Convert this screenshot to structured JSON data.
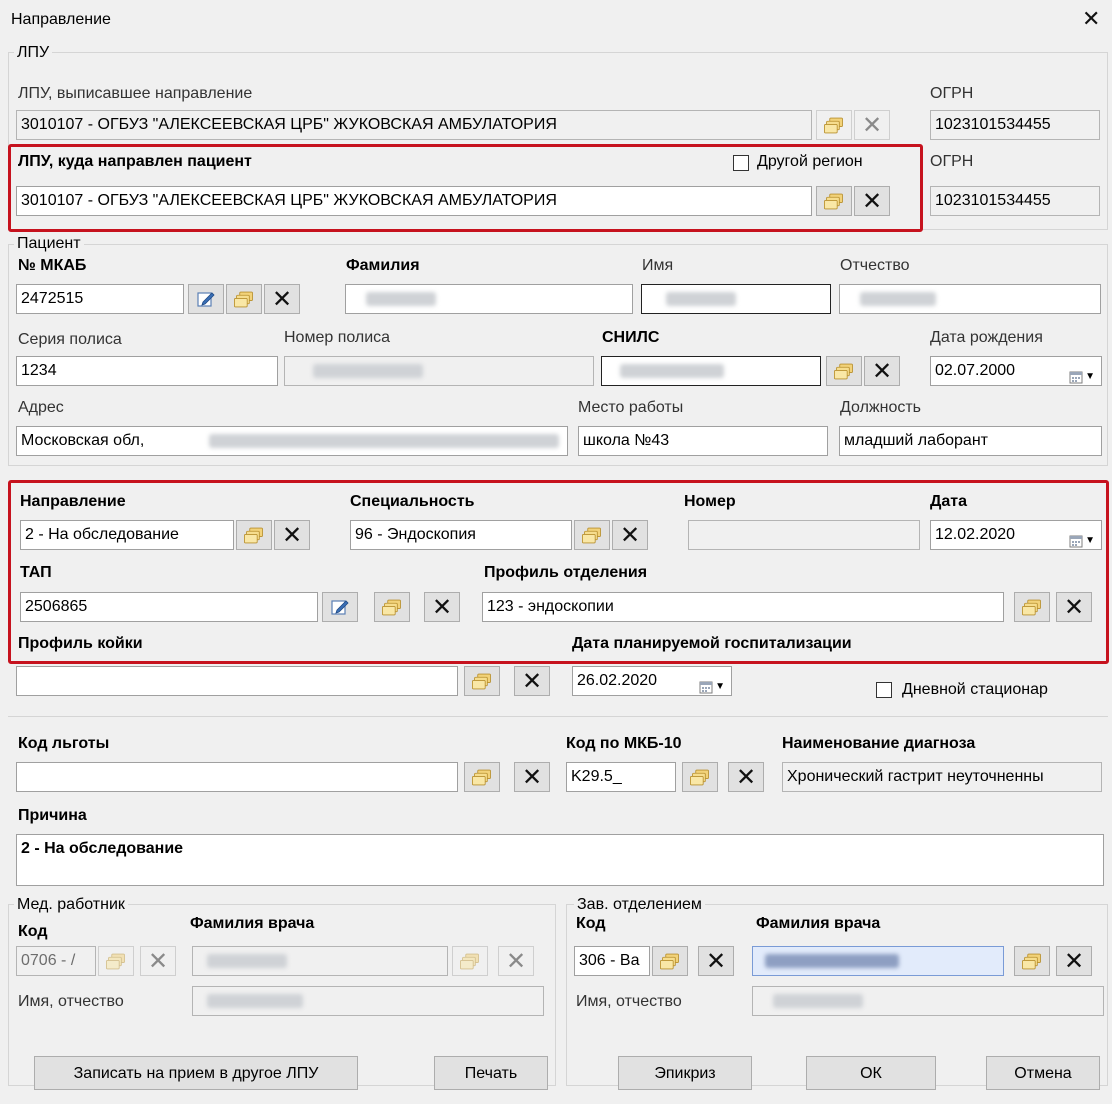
{
  "window": {
    "title": "Направление"
  },
  "lpu": {
    "legend": "ЛПУ",
    "issuer_label": "ЛПУ, выписавшее направление",
    "issuer_value": "3010107 - ОГБУЗ \"АЛЕКСЕЕВСКАЯ ЦРБ\" ЖУКОВСКАЯ АМБУЛАТОРИЯ",
    "ogrn_label": "ОГРН",
    "issuer_ogrn": "1023101534455",
    "target_label": "ЛПУ, куда направлен пациент",
    "other_region_label": "Другой регион",
    "target_value": "3010107 - ОГБУЗ \"АЛЕКСЕЕВСКАЯ ЦРБ\" ЖУКОВСКАЯ АМБУЛАТОРИЯ",
    "target_ogrn": "1023101534455"
  },
  "patient": {
    "legend": "Пациент",
    "mkab_label": "№ МКАБ",
    "mkab_value": "2472515",
    "surname_label": "Фамилия",
    "name_label": "Имя",
    "patronymic_label": "Отчество",
    "policy_series_label": "Серия полиса",
    "policy_series_value": "1234",
    "policy_number_label": "Номер полиса",
    "snils_label": "СНИЛС",
    "birthdate_label": "Дата рождения",
    "birthdate_value": "02.07.2000",
    "address_label": "Адрес",
    "address_value": "Московская обл,",
    "workplace_label": "Место работы",
    "workplace_value": "школа №43",
    "position_label": "Должность",
    "position_value": "младший лаборант"
  },
  "referral": {
    "direction_label": "Направление",
    "direction_value": "2 - На обследование",
    "specialty_label": "Специальность",
    "specialty_value": "96 - Эндоскопия",
    "number_label": "Номер",
    "date_label": "Дата",
    "date_value": "12.02.2020",
    "tap_label": "ТАП",
    "tap_value": "2506865",
    "dept_profile_label": "Профиль отделения",
    "dept_profile_value": "123 - эндоскопии"
  },
  "bed": {
    "bed_profile_label": "Профиль койки",
    "hosp_date_label": "Дата планируемой госпитализации",
    "hosp_date_value": "26.02.2020",
    "day_hospital_label": "Дневной стационар"
  },
  "diagnosis": {
    "benefit_label": "Код льготы",
    "mkb_label": "Код по МКБ-10",
    "mkb_value": "K29.5_",
    "diag_name_label": "Наименование диагноза",
    "diag_name_value": "Хронический гастрит неуточненны"
  },
  "reason": {
    "label": "Причина",
    "value": "2 - На обследование"
  },
  "med_worker": {
    "legend": "Мед. работник",
    "code_label": "Код",
    "code_value": "0706 - /",
    "doctor_label": "Фамилия врача",
    "name_label": "Имя, отчество"
  },
  "head_dept": {
    "legend": "Зав. отделением",
    "code_label": "Код",
    "code_value": "306 - Ва",
    "doctor_label": "Фамилия врача",
    "name_label": "Имя, отчество"
  },
  "buttons": {
    "book": "Записать на прием в другое ЛПУ",
    "print": "Печать",
    "epicrisis": "Эпикриз",
    "ok": "ОК",
    "cancel": "Отмена"
  },
  "colors": {
    "highlight": "#c6121e",
    "background": "#f0f0f0"
  }
}
